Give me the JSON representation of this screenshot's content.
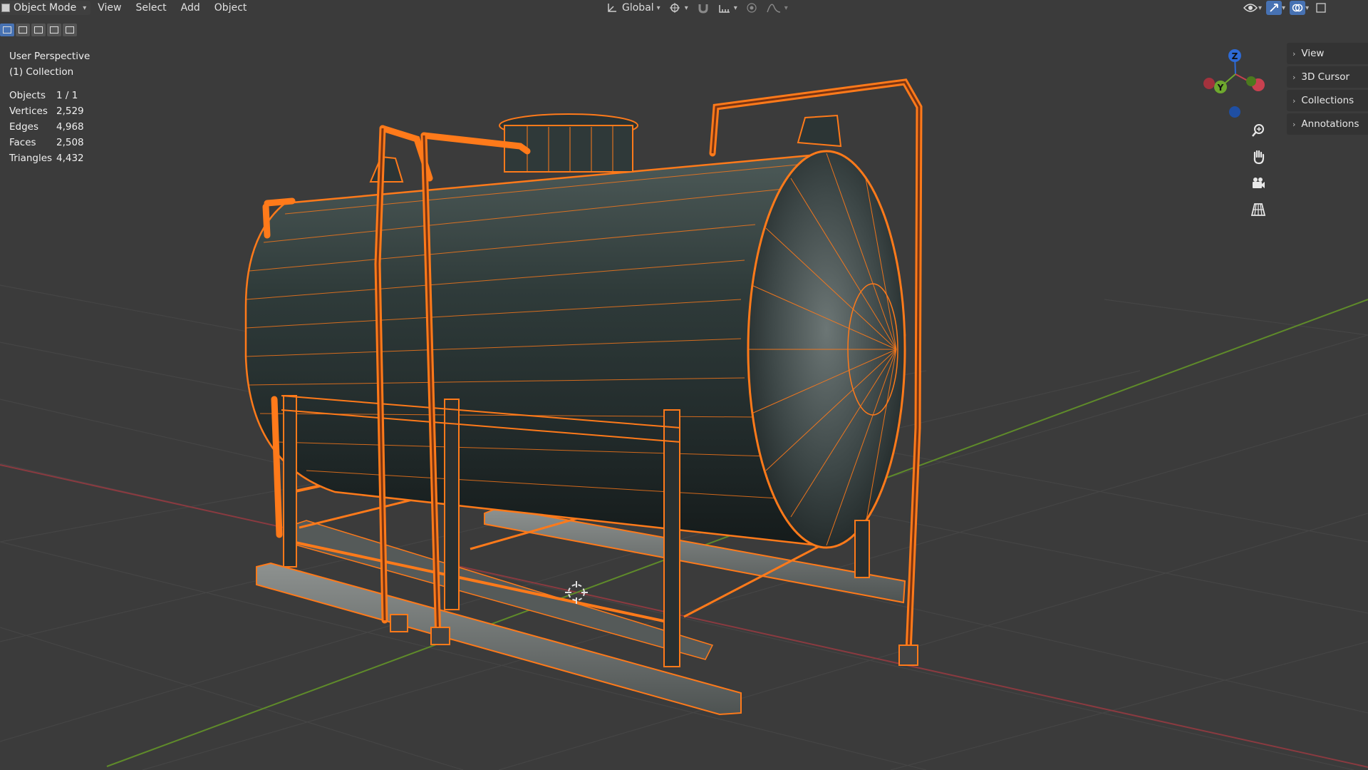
{
  "header": {
    "mode_label": "Object Mode",
    "menus": [
      "View",
      "Select",
      "Add",
      "Object"
    ],
    "transform_orientation": "Global"
  },
  "overlay": {
    "view_name": "User Perspective",
    "collection": "(1) Collection",
    "stats": [
      {
        "label": "Objects",
        "value": "1 / 1"
      },
      {
        "label": "Vertices",
        "value": "2,529"
      },
      {
        "label": "Edges",
        "value": "4,968"
      },
      {
        "label": "Faces",
        "value": "2,508"
      },
      {
        "label": "Triangles",
        "value": "4,432"
      }
    ]
  },
  "gizmo": {
    "axis_z": "Z",
    "axis_y": "Y"
  },
  "nav_icons": [
    "zoom-icon",
    "pan-hand-icon",
    "camera-icon",
    "grid-ortho-icon"
  ],
  "side_panel": {
    "tabs": [
      "View",
      "3D Cursor",
      "Collections",
      "Annotations"
    ]
  },
  "colors": {
    "background": "#3b3b3b",
    "selection_outline": "#ff7a1a",
    "axis_x": "#c8414f",
    "axis_y": "#6ea82e",
    "axis_z": "#2d6ad6",
    "active_button": "#4772b3"
  }
}
